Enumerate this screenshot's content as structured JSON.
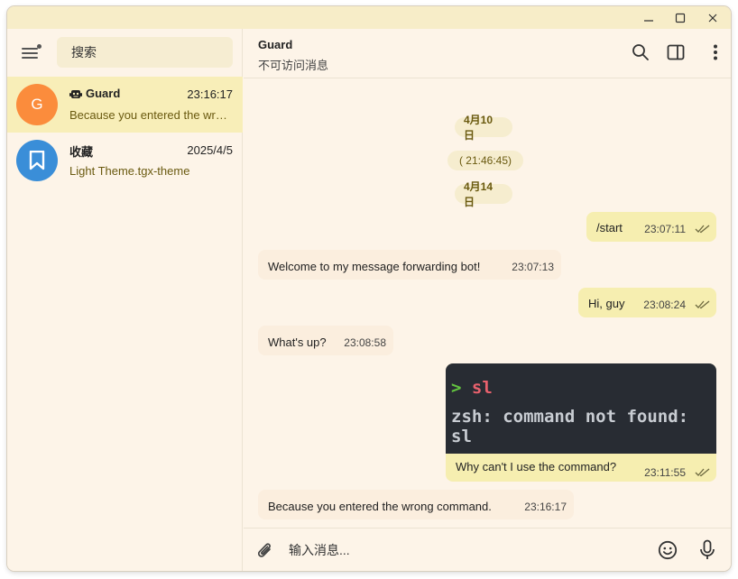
{
  "window": {
    "controls": {
      "minimize": "—",
      "maximize": "☐",
      "close": "✕"
    }
  },
  "sidebar": {
    "search_placeholder": "搜索",
    "chats": [
      {
        "name": "Guard",
        "avatar_letter": "G",
        "avatar_color": "#fb8c3c",
        "time": "23:16:17",
        "preview": "Because you entered the wrong command.",
        "bot_icon": "bot-icon",
        "active": true
      },
      {
        "name": "收藏",
        "avatar_icon": "bookmark-icon",
        "avatar_color": "#3a8ed8",
        "time": "2025/4/5",
        "preview": "Light Theme.tgx-theme",
        "active": false
      }
    ]
  },
  "header": {
    "peer_name": "Guard",
    "peer_status": "不可访问消息",
    "icons": [
      "search-icon",
      "sidebar-toggle-icon",
      "more-icon"
    ]
  },
  "messages": {
    "dates": [
      "4月10日",
      "( 21:46:45)",
      "4月14日"
    ],
    "items": [
      {
        "dir": "out",
        "text": "/start",
        "time": "23:07:11"
      },
      {
        "dir": "in",
        "text": "Welcome to my message forwarding bot!",
        "time": "23:07:13"
      },
      {
        "dir": "out",
        "text": "Hi, guy",
        "time": "23:08:24"
      },
      {
        "dir": "in",
        "text": "What's up?",
        "time": "23:08:58"
      },
      {
        "dir": "out",
        "image_terminal": {
          "prompt": ">",
          "command": "sl",
          "output": "zsh: command not found: sl"
        },
        "text": "Why can't I use the command?",
        "time": "23:11:55"
      },
      {
        "dir": "in",
        "text": "Because you entered the wrong command.",
        "time": "23:16:17"
      }
    ]
  },
  "composer": {
    "placeholder": "输入消息...",
    "icons": [
      "attach-icon",
      "emoji-icon",
      "microphone-icon"
    ]
  },
  "colors": {
    "background": "#fdf4e8",
    "accent_active": "#f8eeb8",
    "out_bubble": "#f6eeb0",
    "in_bubble": "#fbeede",
    "titlebar": "#f7edc8"
  }
}
